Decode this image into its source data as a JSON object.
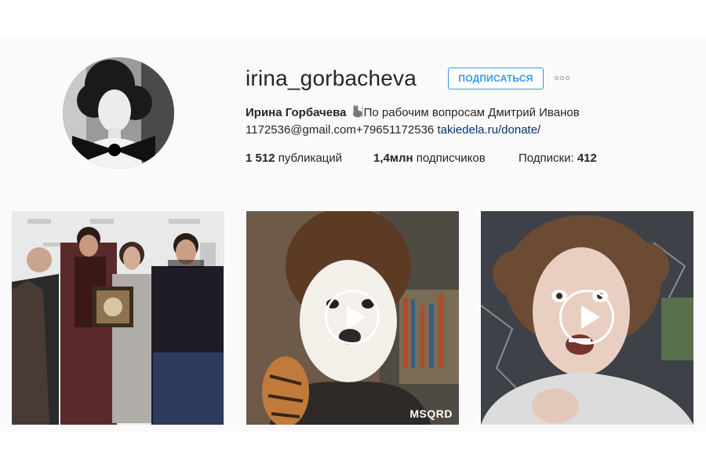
{
  "profile": {
    "username": "irina_gorbacheva",
    "follow_label": "ПОДПИСАТЬСЯ",
    "bio_name": "Ирина Горбачева",
    "bio_text": "По рабочим вопросам Дмитрий Иванов",
    "bio_contact": "1172536@gmail.com+79651172536",
    "bio_link": "takiedela.ru/donate/",
    "stats": {
      "posts_value": "1 512",
      "posts_label": "публикаций",
      "followers_value": "1,4млн",
      "followers_label": "подписчиков",
      "following_label": "Подписки:",
      "following_value": "412"
    }
  },
  "posts": [
    {
      "type": "photo"
    },
    {
      "type": "video",
      "badge": "MSQRD"
    },
    {
      "type": "video"
    }
  ],
  "colors": {
    "accent": "#3897f0",
    "link": "#003569",
    "background": "#fafafa"
  },
  "icons": {
    "more": "ellipsis-icon",
    "bio_emoji": "rabbit-icon",
    "play": "play-icon"
  }
}
